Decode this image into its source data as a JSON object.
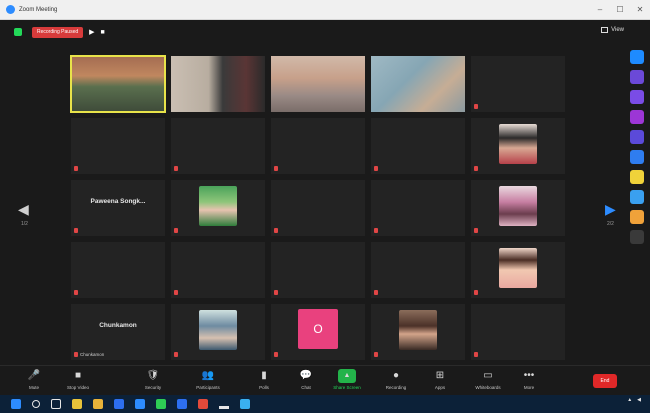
{
  "window": {
    "title": "Zoom Meeting",
    "controls": {
      "minimize": "–",
      "maximize": "☐",
      "close": "✕"
    }
  },
  "topbar": {
    "recording_label": "Recording Paused",
    "rec_resume": "▶",
    "rec_stop": "■",
    "view_label": "View"
  },
  "participants": [
    {
      "caption": "",
      "kind": "video",
      "style": "v1",
      "active": true
    },
    {
      "caption": "",
      "kind": "video",
      "style": "v2"
    },
    {
      "caption": "",
      "kind": "video",
      "style": "v3"
    },
    {
      "caption": "",
      "kind": "video",
      "style": "v4"
    },
    {
      "caption": "",
      "kind": "blank",
      "muted": true
    },
    {
      "caption": "",
      "kind": "blank",
      "muted": true
    },
    {
      "caption": "",
      "kind": "blank",
      "muted": true
    },
    {
      "caption": "",
      "kind": "blank",
      "muted": true
    },
    {
      "caption": "",
      "kind": "blank",
      "muted": true
    },
    {
      "caption": "",
      "kind": "photo",
      "style": "ph4",
      "muted": true
    },
    {
      "name": "Paweena Songk...",
      "caption": "",
      "kind": "name",
      "muted": true
    },
    {
      "caption": "",
      "kind": "photo",
      "style": "ph2",
      "muted": true
    },
    {
      "caption": "",
      "kind": "blank",
      "muted": true
    },
    {
      "caption": "",
      "kind": "blank",
      "muted": true
    },
    {
      "caption": "",
      "kind": "photo",
      "style": "ph3",
      "muted": true
    },
    {
      "caption": "",
      "kind": "blank",
      "muted": true
    },
    {
      "caption": "",
      "kind": "blank",
      "muted": true
    },
    {
      "caption": "",
      "kind": "blank",
      "muted": true
    },
    {
      "caption": "",
      "kind": "blank",
      "muted": true
    },
    {
      "caption": "",
      "kind": "photo",
      "style": "ph1",
      "muted": true
    },
    {
      "name": "Chunkamon",
      "caption": "Chunkamon",
      "kind": "name",
      "muted": true
    },
    {
      "caption": "",
      "kind": "photo",
      "style": "ph5",
      "muted": true
    },
    {
      "caption": "",
      "kind": "avatar",
      "avatar_letter": "O",
      "muted": true
    },
    {
      "caption": "",
      "kind": "photo",
      "style": "ph6",
      "muted": true
    },
    {
      "caption": "",
      "kind": "blank",
      "muted": true
    }
  ],
  "pagination": {
    "left_arrow": "◀",
    "right_arrow": "▶",
    "left_page": "1/2",
    "right_page": "2/2"
  },
  "side_apps": [
    {
      "icon": "zoom-apps-icon",
      "color": "#1e8bff"
    },
    {
      "icon": "app-icon-purple",
      "color": "#6b49d8"
    },
    {
      "icon": "app-icon-violet",
      "color": "#7a4ce6"
    },
    {
      "icon": "app-icon-magenta",
      "color": "#9c36d6"
    },
    {
      "icon": "app-icon-indigo",
      "color": "#5b4ad9"
    },
    {
      "icon": "app-icon-blue",
      "color": "#2f7df0"
    },
    {
      "icon": "app-icon-yellow",
      "color": "#f0d23a"
    },
    {
      "icon": "app-icon-sky",
      "color": "#3aa0f0"
    },
    {
      "icon": "app-icon-orange",
      "color": "#f0a23a"
    },
    {
      "icon": "add-app-icon",
      "color": "#3a3a3a"
    }
  ],
  "controls": [
    {
      "icon": "🎤",
      "label": "Mute",
      "name": "mute-button"
    },
    {
      "icon": "■",
      "label": "Stop Video",
      "name": "stop-video-button"
    },
    {
      "icon": "🛡",
      "label": "Security",
      "name": "security-button"
    },
    {
      "icon": "👥",
      "label": "Participants",
      "name": "participants-button"
    },
    {
      "icon": "▮",
      "label": "Polls",
      "name": "polls-button"
    },
    {
      "icon": "💬",
      "label": "Chat",
      "name": "chat-button"
    },
    {
      "icon": "▲",
      "label": "Share Screen",
      "name": "share-screen-button"
    },
    {
      "icon": "●",
      "label": "Recording",
      "name": "record-button"
    },
    {
      "icon": "⊞",
      "label": "Apps",
      "name": "apps-button"
    },
    {
      "icon": "▭",
      "label": "Whiteboards",
      "name": "whiteboards-button"
    },
    {
      "icon": "•••",
      "label": "More",
      "name": "more-button"
    }
  ],
  "end_label": "End",
  "taskbar": {
    "apps": [
      {
        "icon": "windows-start-icon",
        "color": "#2d8cff"
      },
      {
        "icon": "search-icon",
        "color": "#0c2138"
      },
      {
        "icon": "task-view-icon",
        "color": "#0c2138"
      },
      {
        "icon": "chrome-icon",
        "color": "#e8c33a"
      },
      {
        "icon": "file-explorer-icon",
        "color": "#e8b33a"
      },
      {
        "icon": "store-icon",
        "color": "#2d6ff0"
      },
      {
        "icon": "zoom-taskbar-icon",
        "color": "#2d8cff"
      },
      {
        "icon": "line-icon",
        "color": "#2ecc55"
      },
      {
        "icon": "mail-icon",
        "color": "#2d6ff0"
      },
      {
        "icon": "photos-icon",
        "color": "#e44a3a"
      },
      {
        "icon": "app-taskbar-icon",
        "color": "#0c2138"
      },
      {
        "icon": "teams-icon",
        "color": "#3ab0f0"
      }
    ],
    "clock_time": "",
    "clock_date": ""
  }
}
